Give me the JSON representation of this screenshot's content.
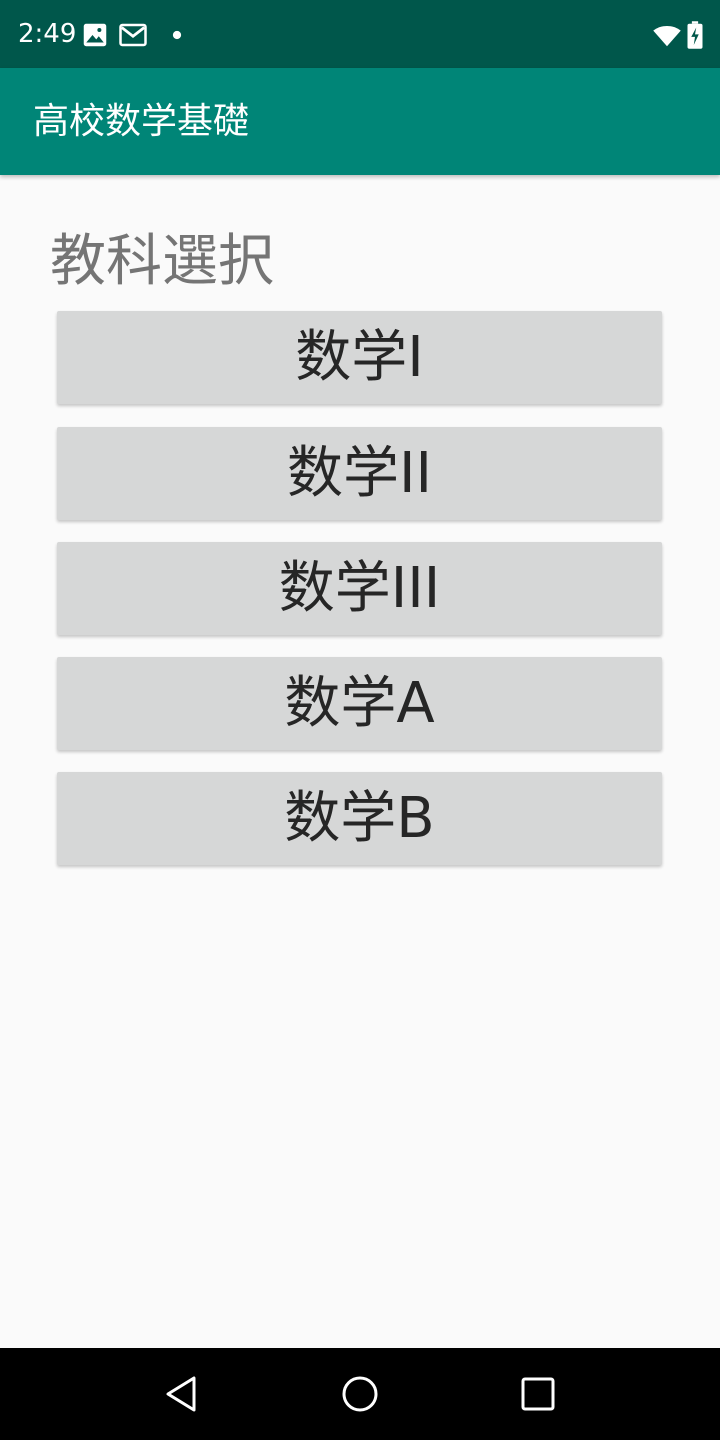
{
  "status_bar": {
    "time": "2:49",
    "icons": [
      "image-icon",
      "gmail-icon",
      "notification-dot-icon",
      "wifi-icon",
      "battery-charging-icon"
    ]
  },
  "app_bar": {
    "title": "高校数学基礎"
  },
  "main": {
    "section_title": "教科選択",
    "buttons": [
      {
        "label": "数学I"
      },
      {
        "label": "数学II"
      },
      {
        "label": "数学III"
      },
      {
        "label": "数学A"
      },
      {
        "label": "数学B"
      }
    ]
  },
  "nav_bar": {
    "icons": [
      "back-icon",
      "home-icon",
      "recents-icon"
    ]
  },
  "colors": {
    "status_bar": "#00574b",
    "app_bar": "#008577",
    "button_bg": "#d6d7d7",
    "section_title": "#757575",
    "background": "#fafafa"
  }
}
